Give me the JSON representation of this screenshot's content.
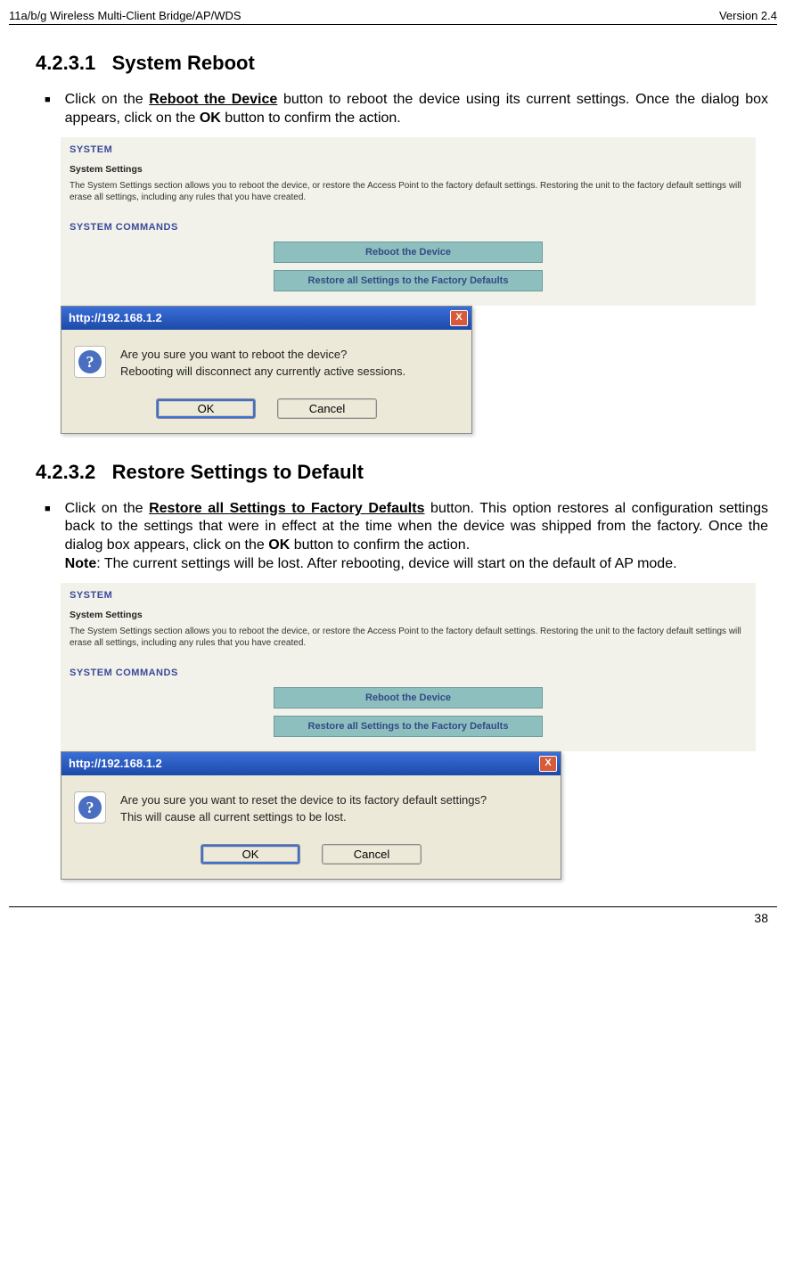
{
  "header": {
    "left": "11a/b/g Wireless Multi-Client Bridge/AP/WDS",
    "right": "Version 2.4"
  },
  "sec1": {
    "num": "4.2.3.1",
    "title": "System Reboot",
    "bullet_pre": "Click on the ",
    "bullet_strong1": "Reboot the Device",
    "bullet_mid": " button to reboot the device using its current settings. Once the dialog box appears, click on the ",
    "bullet_strong2": "OK",
    "bullet_post": " button to confirm the action."
  },
  "panel": {
    "title": "SYSTEM",
    "subtitle": "System Settings",
    "desc": "The System Settings section allows you to reboot the device, or restore the Access Point to the factory default settings. Restoring the unit to the factory default settings will erase all settings, including any rules that you have created.",
    "cmds_title": "SYSTEM COMMANDS",
    "btn_reboot": "Reboot the Device",
    "btn_restore": "Restore all Settings to the Factory Defaults"
  },
  "dlg1": {
    "title": "http://192.168.1.2",
    "line1": "Are you sure you want to reboot the device?",
    "line2": "Rebooting will disconnect any currently active sessions.",
    "ok": "OK",
    "cancel": "Cancel"
  },
  "sec2": {
    "num": "4.2.3.2",
    "title": "Restore Settings to Default",
    "bullet_pre": "Click on the ",
    "bullet_strong1": "Restore all Settings to Factory Defaults",
    "bullet_mid": " button. This option restores al configuration settings back to the settings that were in effect at the time when the device was shipped from the factory. Once the dialog box appears, click on the ",
    "bullet_strong2": "OK",
    "bullet_post": " button to confirm the action.",
    "note_label": "Note",
    "note_text": ": The current settings will be lost. After rebooting, device will start on the default of AP mode."
  },
  "dlg2": {
    "title": "http://192.168.1.2",
    "line1": "Are you sure you want to reset the device to its factory default settings?",
    "line2": "This will cause all current settings to be lost.",
    "ok": "OK",
    "cancel": "Cancel"
  },
  "footer": {
    "page": "38"
  }
}
